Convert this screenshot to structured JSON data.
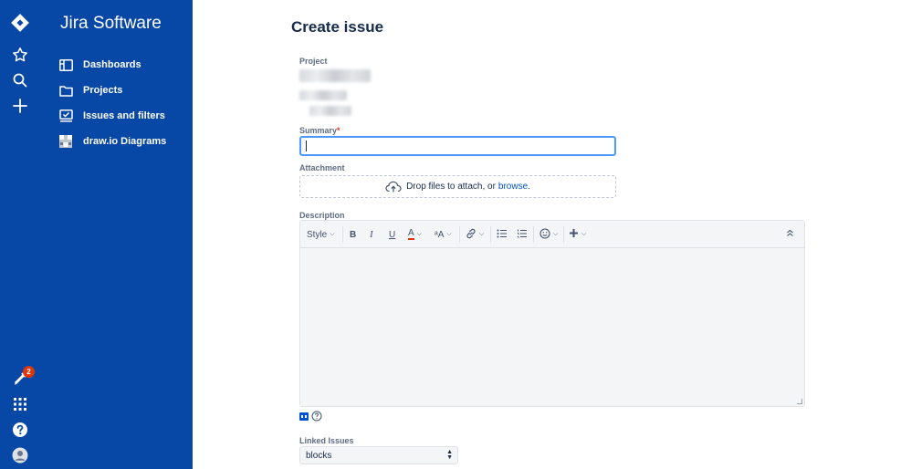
{
  "app": {
    "brand": "Jira Software"
  },
  "rail": {
    "icons": [
      "jira-logo",
      "star-icon",
      "search-icon",
      "plus-icon",
      "notification-icon",
      "app-switcher-icon",
      "help-icon",
      "profile-icon"
    ],
    "notification_count": "2"
  },
  "sidebar": {
    "items": [
      {
        "label": "Dashboards",
        "icon": "dashboard-icon"
      },
      {
        "label": "Projects",
        "icon": "folder-icon"
      },
      {
        "label": "Issues and filters",
        "icon": "issues-icon"
      },
      {
        "label": "draw.io Diagrams",
        "icon": "drawio-icon"
      }
    ]
  },
  "form": {
    "title": "Create issue",
    "project_label": "Project",
    "summary_label": "Summary",
    "summary_required_mark": "*",
    "summary_value": "",
    "attachment_label": "Attachment",
    "attachment_text": "Drop files to attach, or",
    "attachment_link": "browse.",
    "description_label": "Description",
    "toolbar": {
      "style_label": "Style",
      "bold": "B",
      "italic": "I",
      "underline": "U",
      "text_color": "A",
      "text_size": "ᵃA"
    },
    "linked_issues_label": "Linked Issues",
    "linked_issues_value": "blocks"
  },
  "colors": {
    "sidebar_bg": "#0747a6",
    "focus_border": "#4c9aff",
    "link": "#0052cc",
    "required": "#de350b"
  }
}
